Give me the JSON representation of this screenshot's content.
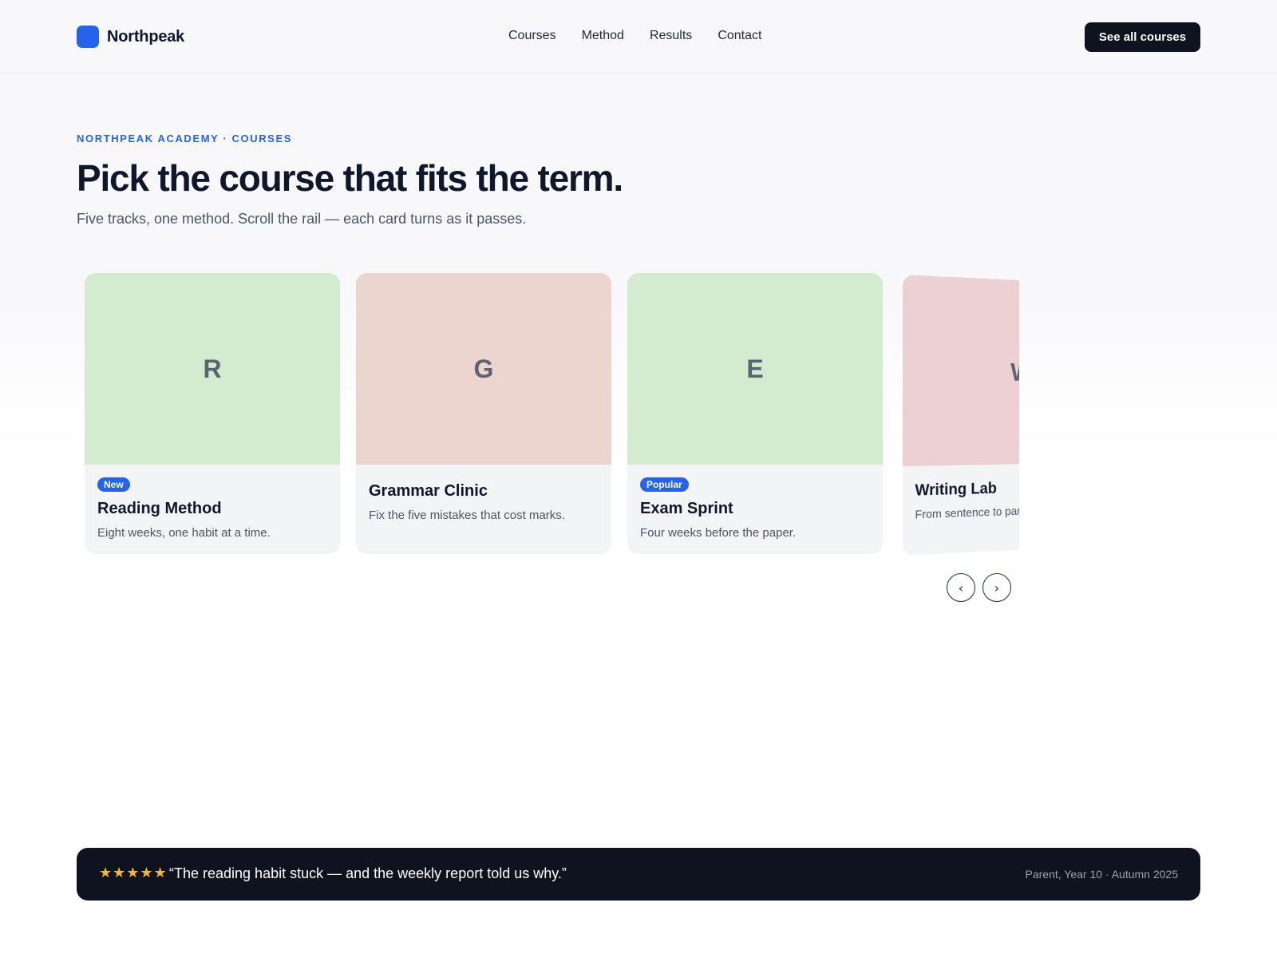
{
  "header": {
    "brand": "Northpeak",
    "nav": [
      "Courses",
      "Method",
      "Results",
      "Contact"
    ],
    "cta": "See all courses",
    "brand_color": "#2563eb"
  },
  "hero": {
    "eyebrow": "NORTHPEAK ACADEMY · COURSES",
    "title": "Pick the course that fits the term.",
    "subtitle": "Five tracks, one method. Scroll the rail — each card turns as it passes."
  },
  "courses": [
    {
      "letter": "R",
      "badge": "New",
      "title": "Reading Method",
      "desc": "Eight weeks, one habit at a time.",
      "color": "#d3ebce"
    },
    {
      "letter": "G",
      "badge": "",
      "title": "Grammar Clinic",
      "desc": "Fix the five mistakes that cost marks.",
      "color": "#ecd5ce"
    },
    {
      "letter": "E",
      "badge": "Popular",
      "title": "Exam Sprint",
      "desc": "Four weeks before the paper.",
      "color": "#d3ebce"
    },
    {
      "letter": "W",
      "badge": "",
      "title": "Writing Lab",
      "desc": "From sentence to paragraph.",
      "color": "#ecd0d4"
    }
  ],
  "rail": {
    "prev_icon": "chevron-left-icon",
    "next_icon": "chevron-right-icon",
    "prev_glyph": "‹",
    "next_glyph": "›"
  },
  "testimonial": {
    "stars": "★★★★★",
    "rating": 5,
    "quote": "“The reading habit stuck — and the weekly report told us why.”",
    "attribution": "Parent, Year 10 · Autumn 2025"
  }
}
